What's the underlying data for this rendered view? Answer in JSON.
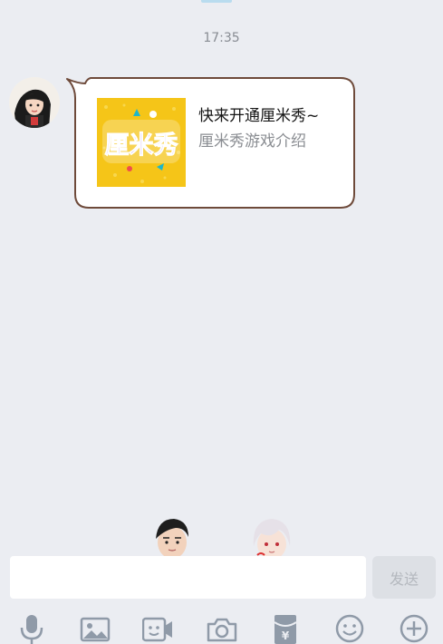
{
  "chat": {
    "timestamp": "17:35",
    "message": {
      "title": "快来开通厘米秀~",
      "subtitle": "厘米秀游戏介绍",
      "logo_text": "厘米秀"
    }
  },
  "composer": {
    "input_value": "",
    "send_label": "发送"
  },
  "toolbar": {
    "icons": [
      "mic-icon",
      "image-icon",
      "video-call-icon",
      "camera-icon",
      "red-packet-icon",
      "emoji-icon",
      "plus-icon"
    ]
  },
  "colors": {
    "background": "#ebedf2",
    "bubble_border": "#6e4a3a",
    "thumb_yellow": "#f5c518",
    "logo_purple": "#7a3cc6",
    "toolbar_icon": "#8f9aa8"
  }
}
